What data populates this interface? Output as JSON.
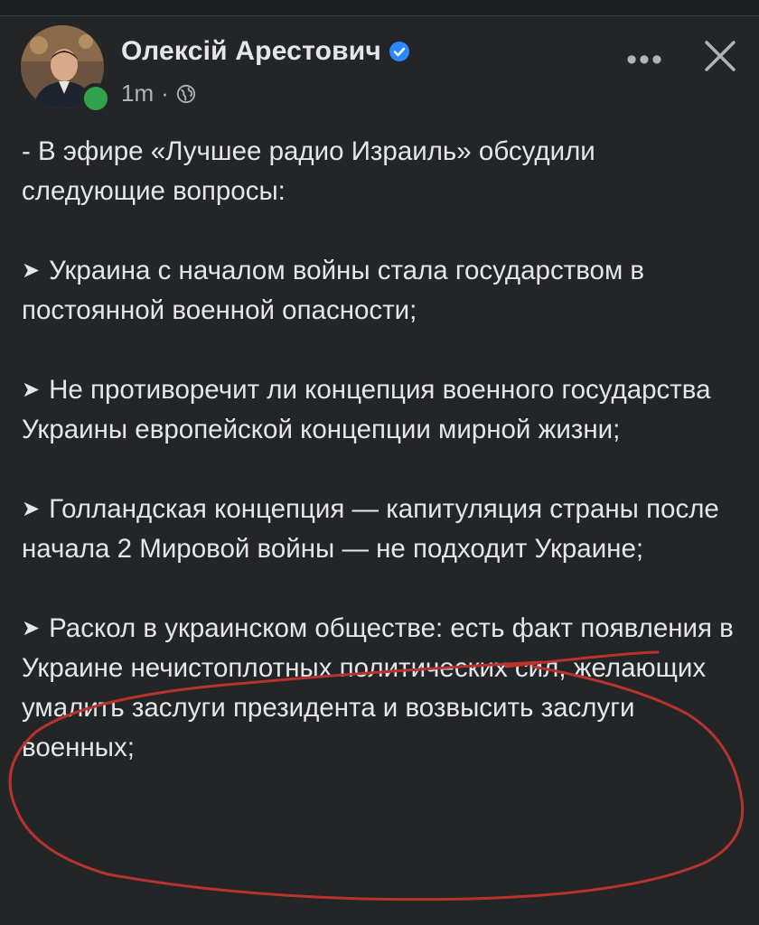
{
  "post": {
    "author": "Олексій Арестович",
    "time": "1m",
    "separator": "·",
    "more_label": "•••",
    "icons": {
      "verified": "verified-badge-icon",
      "audience": "globe-icon",
      "more": "more-options-icon",
      "close": "close-icon"
    },
    "accent_color": "#2d88ff",
    "online_color": "#31a24c",
    "annotation_color": "#b8332f",
    "paragraphs": [
      {
        "bullet": "",
        "text": "- В эфире «Лучшее радио Израиль» обсудили следующие вопросы:"
      },
      {
        "bullet": "➤",
        "text": "Украина с началом войны стала государством в постоянной военной опасности;"
      },
      {
        "bullet": "➤",
        "text": "Не противоречит ли концепция военного государства Украины европейской концепции мирной жизни;"
      },
      {
        "bullet": "➤",
        "text": "Голландская концепция — капитуляция страны после начала 2 Мировой войны — не подходит Украине;"
      },
      {
        "bullet": "➤",
        "text": "Раскол в украинском обществе: есть факт появления в Украине нечистоплотных политических сил, желающих умалить заслуги президента и возвысить заслуги военных;"
      }
    ]
  }
}
